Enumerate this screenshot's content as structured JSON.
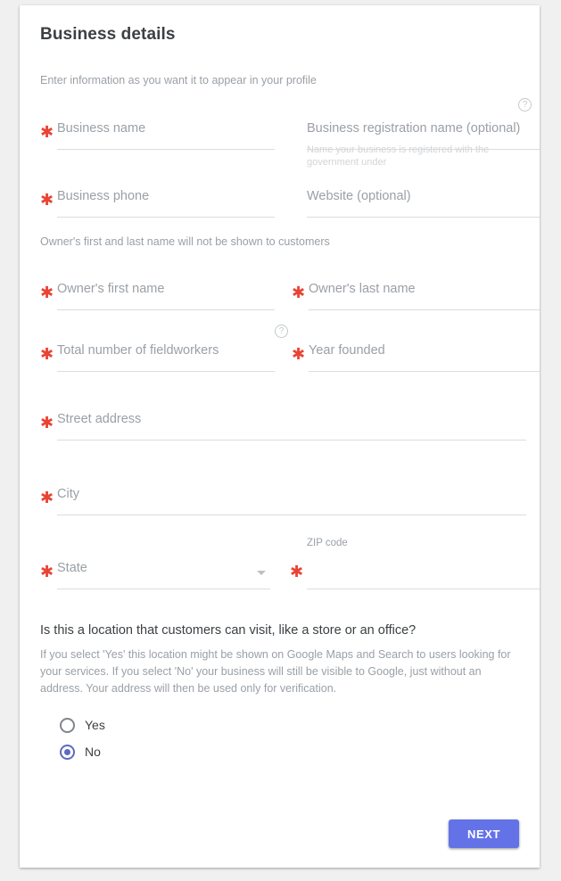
{
  "header": {
    "title": "Business details",
    "subtitle": "Enter information as you want it to appear in your profile"
  },
  "notes": {
    "owner_note": "Owner's first and last name will not be shown to customers",
    "registration_helper": "Name your business is registered with the government under"
  },
  "icons": {
    "help": "?",
    "help_name": "help-circle-icon",
    "dropdown": "chevron-down-icon"
  },
  "fields": {
    "business_name": {
      "label": "Business name",
      "value": "",
      "required": true
    },
    "business_registration_name": {
      "label": "Business registration name (optional)",
      "value": "",
      "required": false
    },
    "business_phone": {
      "label": "Business phone",
      "value": "",
      "required": true
    },
    "website": {
      "label": "Website (optional)",
      "value": "",
      "required": false
    },
    "owner_first_name": {
      "label": "Owner's first name",
      "value": "",
      "required": true
    },
    "owner_last_name": {
      "label": "Owner's last name",
      "value": "",
      "required": true
    },
    "total_fieldworkers": {
      "label": "Total number of fieldworkers",
      "value": "",
      "required": true
    },
    "year_founded": {
      "label": "Year founded",
      "value": "",
      "required": true
    },
    "street_address": {
      "label": "Street address",
      "value": "",
      "required": true
    },
    "city": {
      "label": "City",
      "value": "",
      "required": true
    },
    "state": {
      "label": "State",
      "value": "",
      "required": true
    },
    "zip_code": {
      "label": "ZIP code",
      "value": "",
      "required": true
    }
  },
  "location_question": {
    "title": "Is this a location that customers can visit, like a store or an office?",
    "description": "If you select 'Yes' this location might be shown on Google Maps and Search to users looking for your services. If you select 'No' your business will still be visible to Google, just without an address. Your address will then be used only for verification.",
    "options": [
      {
        "label": "Yes",
        "selected": false
      },
      {
        "label": "No",
        "selected": true
      }
    ]
  },
  "actions": {
    "next_label": "NEXT"
  },
  "colors": {
    "required_star": "#ea4335",
    "accent": "#6472e8",
    "radio_selected": "#5c6bc0",
    "underline": "#dadce0",
    "placeholder": "#9aa0a6",
    "title": "#3c4043",
    "page_background": "#f0f0f0",
    "card_background": "#ffffff"
  }
}
